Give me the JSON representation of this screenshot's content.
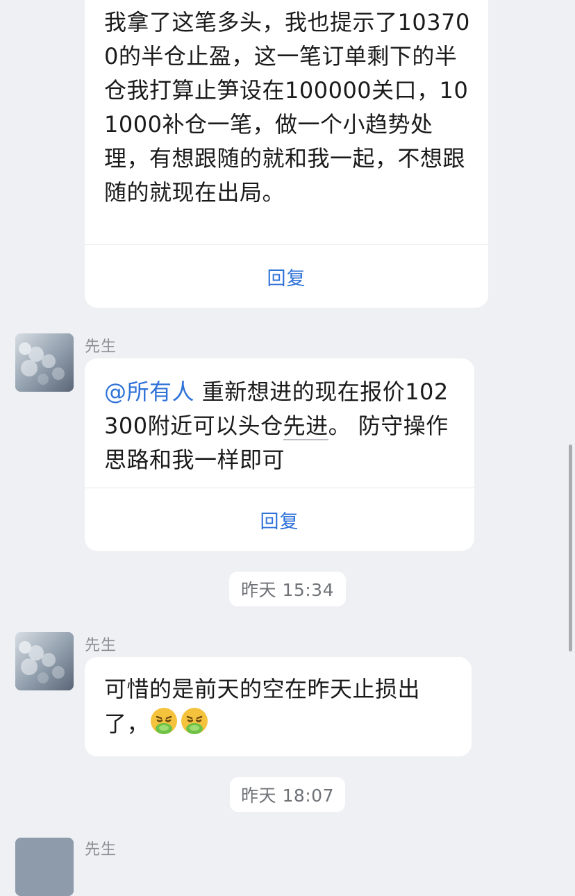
{
  "messages": [
    {
      "text": "我拿了这笔多头，我也提示了103700的半仓止盈，这一笔订单剩下的半仓我打算止笋设在100000关口，101000补仓一笔，做一个小趋势处理，有想跟随的就和我一起，不想跟随的就现在出局。",
      "reply_label": "回复"
    },
    {
      "sender": "先生",
      "mention": "@所有人",
      "text_before": " 重新想进的现在报价102300附近可以头仓",
      "text_underlined": "先进",
      "text_after": "。 防守操作思路和我一样即可",
      "reply_label": "回复"
    },
    {
      "sender": "先生",
      "text": "可惜的是前天的空在昨天止损出了，",
      "emojis": [
        "steam-from-nose-emoji",
        "steam-from-nose-emoji"
      ]
    },
    {
      "sender": "先生"
    }
  ],
  "timestamps": [
    "昨天 15:34",
    "昨天 18:07"
  ],
  "colors": {
    "background": "#eff0f4",
    "bubble": "#ffffff",
    "accent": "#2f72d8",
    "sender": "#8a8d93"
  }
}
